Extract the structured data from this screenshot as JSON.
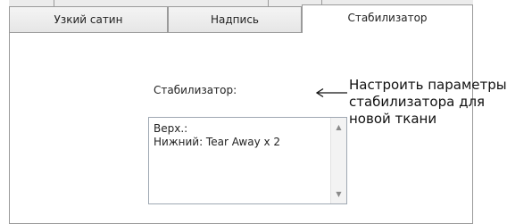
{
  "tabs": [
    {
      "label": "Узкий сатин",
      "active": false
    },
    {
      "label": "Надпись",
      "active": false
    },
    {
      "label": "Стабилизатор",
      "active": true
    }
  ],
  "stabilizer": {
    "label": "Стабилизатор:",
    "text": "Верх.:\nНижний: Tear Away x 2"
  },
  "callout": {
    "text": "Настроить параметры\nстабилизатора для\nновой ткани"
  },
  "icons": {
    "scroll_up": "scroll-up-icon",
    "scroll_down": "scroll-down-icon",
    "callout_arrow": "arrow-left-icon"
  }
}
